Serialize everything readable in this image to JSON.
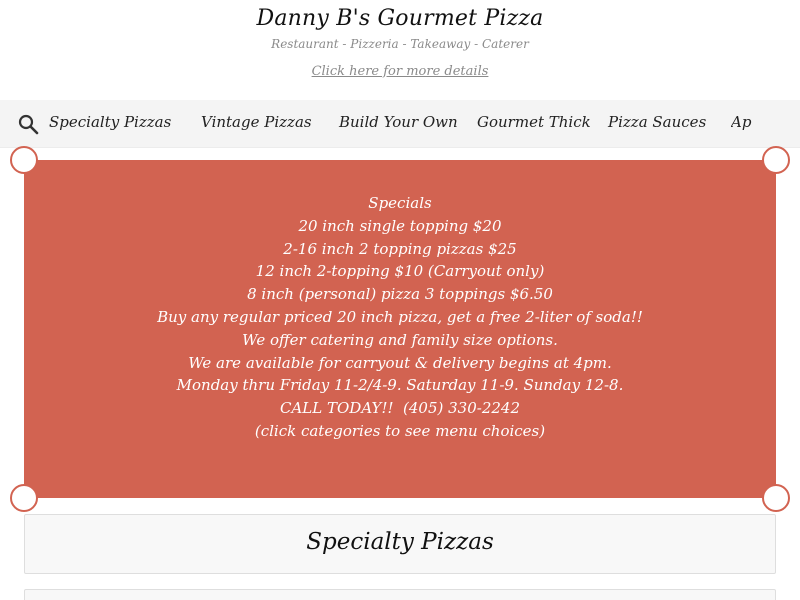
{
  "header": {
    "title": "Danny B's Gourmet Pizza",
    "subtitle": "Restaurant - Pizzeria - Takeaway - Caterer",
    "details_link": "Click here for more details"
  },
  "nav": {
    "search_icon": "search-icon",
    "categories": [
      "Specialty Pizzas",
      "Vintage Pizzas",
      "Build Your Own",
      "Gourmet Thick",
      "Pizza Sauces",
      "Ap"
    ]
  },
  "specials": {
    "lines": [
      "Specials",
      "20 inch single topping $20",
      "2-16 inch 2 topping pizzas $25",
      "12 inch 2-topping $10 (Carryout only)",
      "8 inch (personal) pizza 3 toppings $6.50",
      "Buy any regular priced 20 inch pizza, get a free 2-liter of soda!!",
      "We offer catering and family size options.",
      "We are available for carryout & delivery begins at 4pm.",
      "Monday thru Friday 11-2/4-9. Saturday 11-9. Sunday 12-8.",
      "CALL TODAY!!  (405) 330-2242",
      "",
      "(click categories to see menu choices)"
    ],
    "background_color": "#d26351"
  },
  "section": {
    "title": "Specialty Pizzas"
  }
}
